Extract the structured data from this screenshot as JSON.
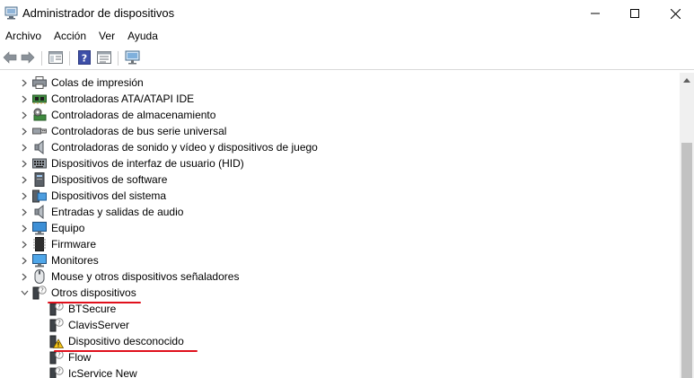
{
  "window": {
    "title": "Administrador de dispositivos",
    "controls": [
      "minimize",
      "maximize",
      "close"
    ]
  },
  "menu": {
    "items": [
      "Archivo",
      "Acción",
      "Ver",
      "Ayuda"
    ]
  },
  "toolbar": {
    "icons": [
      "back-arrow-icon",
      "forward-arrow-icon",
      "properties-window-icon",
      "help-icon",
      "action-pane-icon",
      "scan-hardware-monitor-icon"
    ]
  },
  "tree": {
    "categories": [
      {
        "label": "Colas de impresión",
        "icon": "printer-icon",
        "expanded": false
      },
      {
        "label": "Controladoras ATA/ATAPI IDE",
        "icon": "ide-controller-icon",
        "expanded": false
      },
      {
        "label": "Controladoras de almacenamiento",
        "icon": "storage-controller-icon",
        "expanded": false
      },
      {
        "label": "Controladoras de bus serie universal",
        "icon": "usb-icon",
        "expanded": false
      },
      {
        "label": "Controladoras de sonido y vídeo y dispositivos de juego",
        "icon": "speaker-icon",
        "expanded": false
      },
      {
        "label": "Dispositivos de interfaz de usuario (HID)",
        "icon": "keyboard-icon",
        "expanded": false
      },
      {
        "label": "Dispositivos de software",
        "icon": "software-device-icon",
        "expanded": false
      },
      {
        "label": "Dispositivos del sistema",
        "icon": "system-device-icon",
        "expanded": false
      },
      {
        "label": "Entradas y salidas de audio",
        "icon": "speaker-icon",
        "expanded": false
      },
      {
        "label": "Equipo",
        "icon": "computer-icon",
        "expanded": false
      },
      {
        "label": "Firmware",
        "icon": "firmware-chip-icon",
        "expanded": false
      },
      {
        "label": "Monitores",
        "icon": "monitor-icon",
        "expanded": false
      },
      {
        "label": "Mouse y otros dispositivos señaladores",
        "icon": "mouse-icon",
        "expanded": false
      },
      {
        "label": "Otros dispositivos",
        "icon": "unknown-device-icon",
        "expanded": true
      }
    ],
    "children": [
      {
        "label": "BTSecure",
        "icon": "unknown-device-icon",
        "warning": false
      },
      {
        "label": "ClavisServer",
        "icon": "unknown-device-icon",
        "warning": false
      },
      {
        "label": "Dispositivo desconocido",
        "icon": "unknown-device-warning-icon",
        "warning": true
      },
      {
        "label": "Flow",
        "icon": "unknown-device-icon",
        "warning": false
      },
      {
        "label": "IcService New",
        "icon": "unknown-device-icon",
        "warning": false
      }
    ]
  },
  "colors": {
    "highlight_underline": "#e0101c",
    "scrollbar_track": "#f0f0f0",
    "scrollbar_thumb": "#c2c2c2"
  }
}
